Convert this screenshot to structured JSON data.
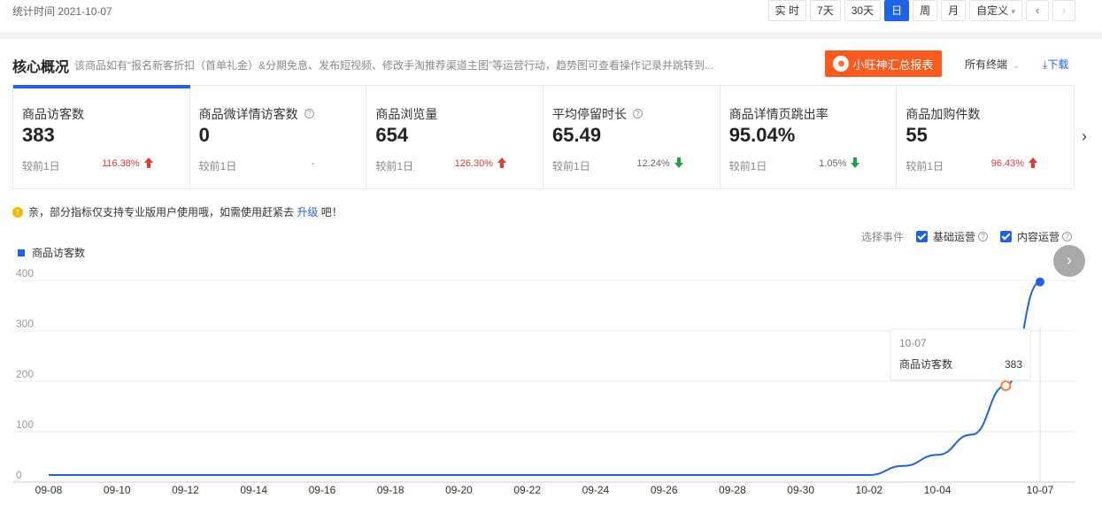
{
  "header": {
    "stat_time": "统计时间 2021-10-07",
    "range_buttons": [
      "实 时",
      "7天",
      "30天",
      "日",
      "周",
      "月",
      "自定义"
    ],
    "active_range": "日",
    "prev_icon": "chevron-left-icon",
    "next_icon": "chevron-right-icon"
  },
  "core": {
    "title": "核心概况",
    "description": "该商品如有“报名新客折扣（首单礼金）&分期免息、发布短视频、修改手淘推荐渠道主图”等运营行动，趋势图可查看操作记录并跳转到...",
    "report_button": "小旺神汇总报表",
    "terminal_label": "所有终端",
    "download_label": "下载",
    "accent_color": "#2062e6",
    "report_color": "#ff5a1e"
  },
  "metrics": [
    {
      "label": "商品访客数",
      "value": "383",
      "compare_label": "较前1日",
      "change": "116.38%",
      "trend": "up",
      "has_help": false
    },
    {
      "label": "商品微详情访客数",
      "value": "0",
      "compare_label": "较前1日",
      "change": "-",
      "trend": "none",
      "has_help": true
    },
    {
      "label": "商品浏览量",
      "value": "654",
      "compare_label": "较前1日",
      "change": "126.30%",
      "trend": "up",
      "has_help": false
    },
    {
      "label": "平均停留时长",
      "value": "65.49",
      "compare_label": "较前1日",
      "change": "12.24%",
      "trend": "down",
      "has_help": true
    },
    {
      "label": "商品详情页跳出率",
      "value": "95.04%",
      "compare_label": "较前1日",
      "change": "1.05%",
      "trend": "down",
      "has_help": false
    },
    {
      "label": "商品加购件数",
      "value": "55",
      "compare_label": "较前1日",
      "change": "96.43%",
      "trend": "up",
      "has_help": false
    }
  ],
  "notice": {
    "prefix": "亲，部分指标仅支持专业版用户使用哦，如需使用赶紧去",
    "link": "升级",
    "suffix": "吧！"
  },
  "events": {
    "label": "选择事件",
    "options": [
      {
        "label": "基础运营",
        "checked": true
      },
      {
        "label": "内容运营",
        "checked": true
      }
    ]
  },
  "legend": {
    "series_name": "商品访客数"
  },
  "tooltip": {
    "date": "10-07",
    "label": "商品访客数",
    "value": "383"
  },
  "chart_data": {
    "type": "line",
    "ylim": [
      0,
      400
    ],
    "y_ticks": [
      0,
      100,
      200,
      300,
      400
    ],
    "x_tick_labels": [
      "09-08",
      "09-10",
      "09-12",
      "09-14",
      "09-16",
      "09-18",
      "09-20",
      "09-22",
      "09-24",
      "09-26",
      "09-28",
      "09-30",
      "10-02",
      "10-04",
      "10-07"
    ],
    "x": [
      "09-08",
      "09-09",
      "09-10",
      "09-11",
      "09-12",
      "09-13",
      "09-14",
      "09-15",
      "09-16",
      "09-17",
      "09-18",
      "09-19",
      "09-20",
      "09-21",
      "09-22",
      "09-23",
      "09-24",
      "09-25",
      "09-26",
      "09-27",
      "09-28",
      "09-29",
      "09-30",
      "10-01",
      "10-02",
      "10-03",
      "10-04",
      "10-05",
      "10-06",
      "10-07"
    ],
    "series": [
      {
        "name": "商品访客数",
        "color": "#2062e6",
        "values": [
          0,
          0,
          0,
          0,
          0,
          0,
          0,
          0,
          0,
          0,
          0,
          0,
          0,
          0,
          0,
          0,
          0,
          0,
          0,
          0,
          0,
          0,
          0,
          0,
          0,
          18,
          40,
          80,
          177,
          383
        ]
      }
    ],
    "highlight_point": {
      "x": "10-06",
      "value": 177
    },
    "grid": true
  }
}
